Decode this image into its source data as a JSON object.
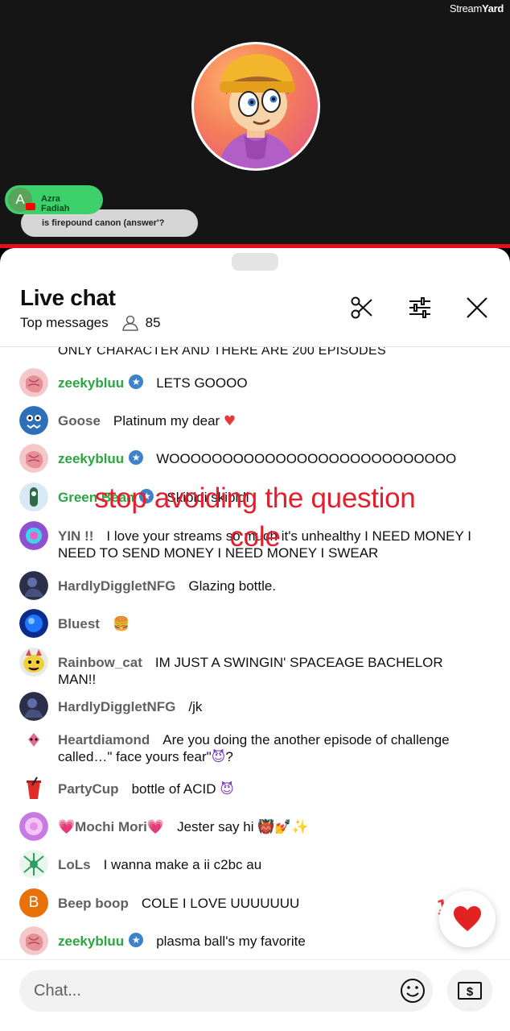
{
  "stream": {
    "brand_light": "Stream",
    "brand_bold": "Yard",
    "overlay": {
      "avatar_letter": "A",
      "name": "Azra Fadiah",
      "message": "is firepound canon (answer'?"
    }
  },
  "chat": {
    "title": "Live chat",
    "mode": "Top messages",
    "viewer_count": "85",
    "cut_message": "ONLY CHARACTER AND THERE ARE 200 EPISODES",
    "messages": [
      {
        "author": "zeekybluu",
        "member": true,
        "text": "LETS GOOOO"
      },
      {
        "author": "Goose",
        "member": false,
        "text": "Platinum my dear",
        "emoji": "♥"
      },
      {
        "author": "zeekybluu",
        "member": true,
        "text": "WOOOOOOOOOOOOOOOOOOOOOOOOOOO"
      },
      {
        "author": "Green Bean",
        "member": true,
        "text": "Skibidi skibidi"
      },
      {
        "author": "YIN !!",
        "member": false,
        "text": "I love your streams so much it's unhealthy I NEED MONEY I NEED TO SEND MONEY I NEED MONEY I SWEAR"
      },
      {
        "author": "HardlyDiggletNFG",
        "member": false,
        "text": "Glazing bottle."
      },
      {
        "author": "Bluest",
        "member": false,
        "text": "",
        "emoji": "🍔"
      },
      {
        "author": "Rainbow_cat",
        "member": false,
        "text": "IM JUST A SWINGIN' SPACEAGE BACHELOR MAN!!"
      },
      {
        "author": "HardlyDiggletNFG",
        "member": false,
        "text": "/jk"
      },
      {
        "author": "Heartdiamond",
        "member": false,
        "text": "Are you doing the another episode of challenge called…\" face yours fear\"",
        "emoji": "😈",
        "suffix": "?"
      },
      {
        "author": "PartyCup",
        "member": false,
        "text": "bottle of ACID",
        "emoji": "😈"
      },
      {
        "author": "💗Mochi Mori💗",
        "member": false,
        "text": "Jester say hi",
        "emoji": "👹💅✨"
      },
      {
        "author": "LoLs",
        "member": false,
        "text": "I wanna make a ii c2bc au"
      },
      {
        "author": "Beep boop",
        "member": false,
        "text": "COLE I LOVE UUUUUUU",
        "avatar_letter": "B"
      },
      {
        "author": "zeekybluu",
        "member": true,
        "text": "plasma ball's my favorite"
      }
    ],
    "caption_line1": "stop avoiding the question",
    "caption_line2": "cole",
    "float_emoji": "100",
    "input_placeholder": "Chat..."
  },
  "colors": {
    "member_name": "#2ba640",
    "regular_name": "#606060",
    "caption": "#e41e2c",
    "stream_bar": "#e0101c"
  }
}
